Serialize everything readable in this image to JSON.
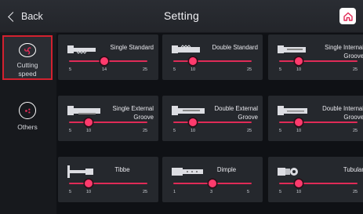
{
  "header": {
    "back_label": "Back",
    "title": "Setting",
    "home_icon": "home-icon"
  },
  "sidebar": {
    "items": [
      {
        "label": "Cutting\nspeed",
        "icon": "fan-icon",
        "active": true
      },
      {
        "label": "Others",
        "icon": "dots-icon",
        "active": false
      }
    ]
  },
  "colors": {
    "accent": "#e02b57",
    "active_border": "#d2212f",
    "card_bg": "#25282d"
  },
  "cards": [
    {
      "name": "Single Standard",
      "min": "5",
      "mid": "14",
      "max": "25",
      "value": 14
    },
    {
      "name": "Double Standard",
      "min": "5",
      "mid": "10",
      "max": "25",
      "value": 10
    },
    {
      "name": "Single Internal\nGroove",
      "min": "5",
      "mid": "10",
      "max": "25",
      "value": 10
    },
    {
      "name": "Single External\nGroove",
      "min": "5",
      "mid": "10",
      "max": "25",
      "value": 10
    },
    {
      "name": "Double External\nGroove",
      "min": "5",
      "mid": "10",
      "max": "25",
      "value": 10
    },
    {
      "name": "Double Internal\nGroove",
      "min": "5",
      "mid": "10",
      "max": "25",
      "value": 10
    },
    {
      "name": "Tibbe",
      "min": "5",
      "mid": "10",
      "max": "25",
      "value": 10
    },
    {
      "name": "Dimple",
      "min": "1",
      "mid": "3",
      "max": "5",
      "value": 3
    },
    {
      "name": "Tubular",
      "min": "5",
      "mid": "10",
      "max": "25",
      "value": 10
    }
  ]
}
